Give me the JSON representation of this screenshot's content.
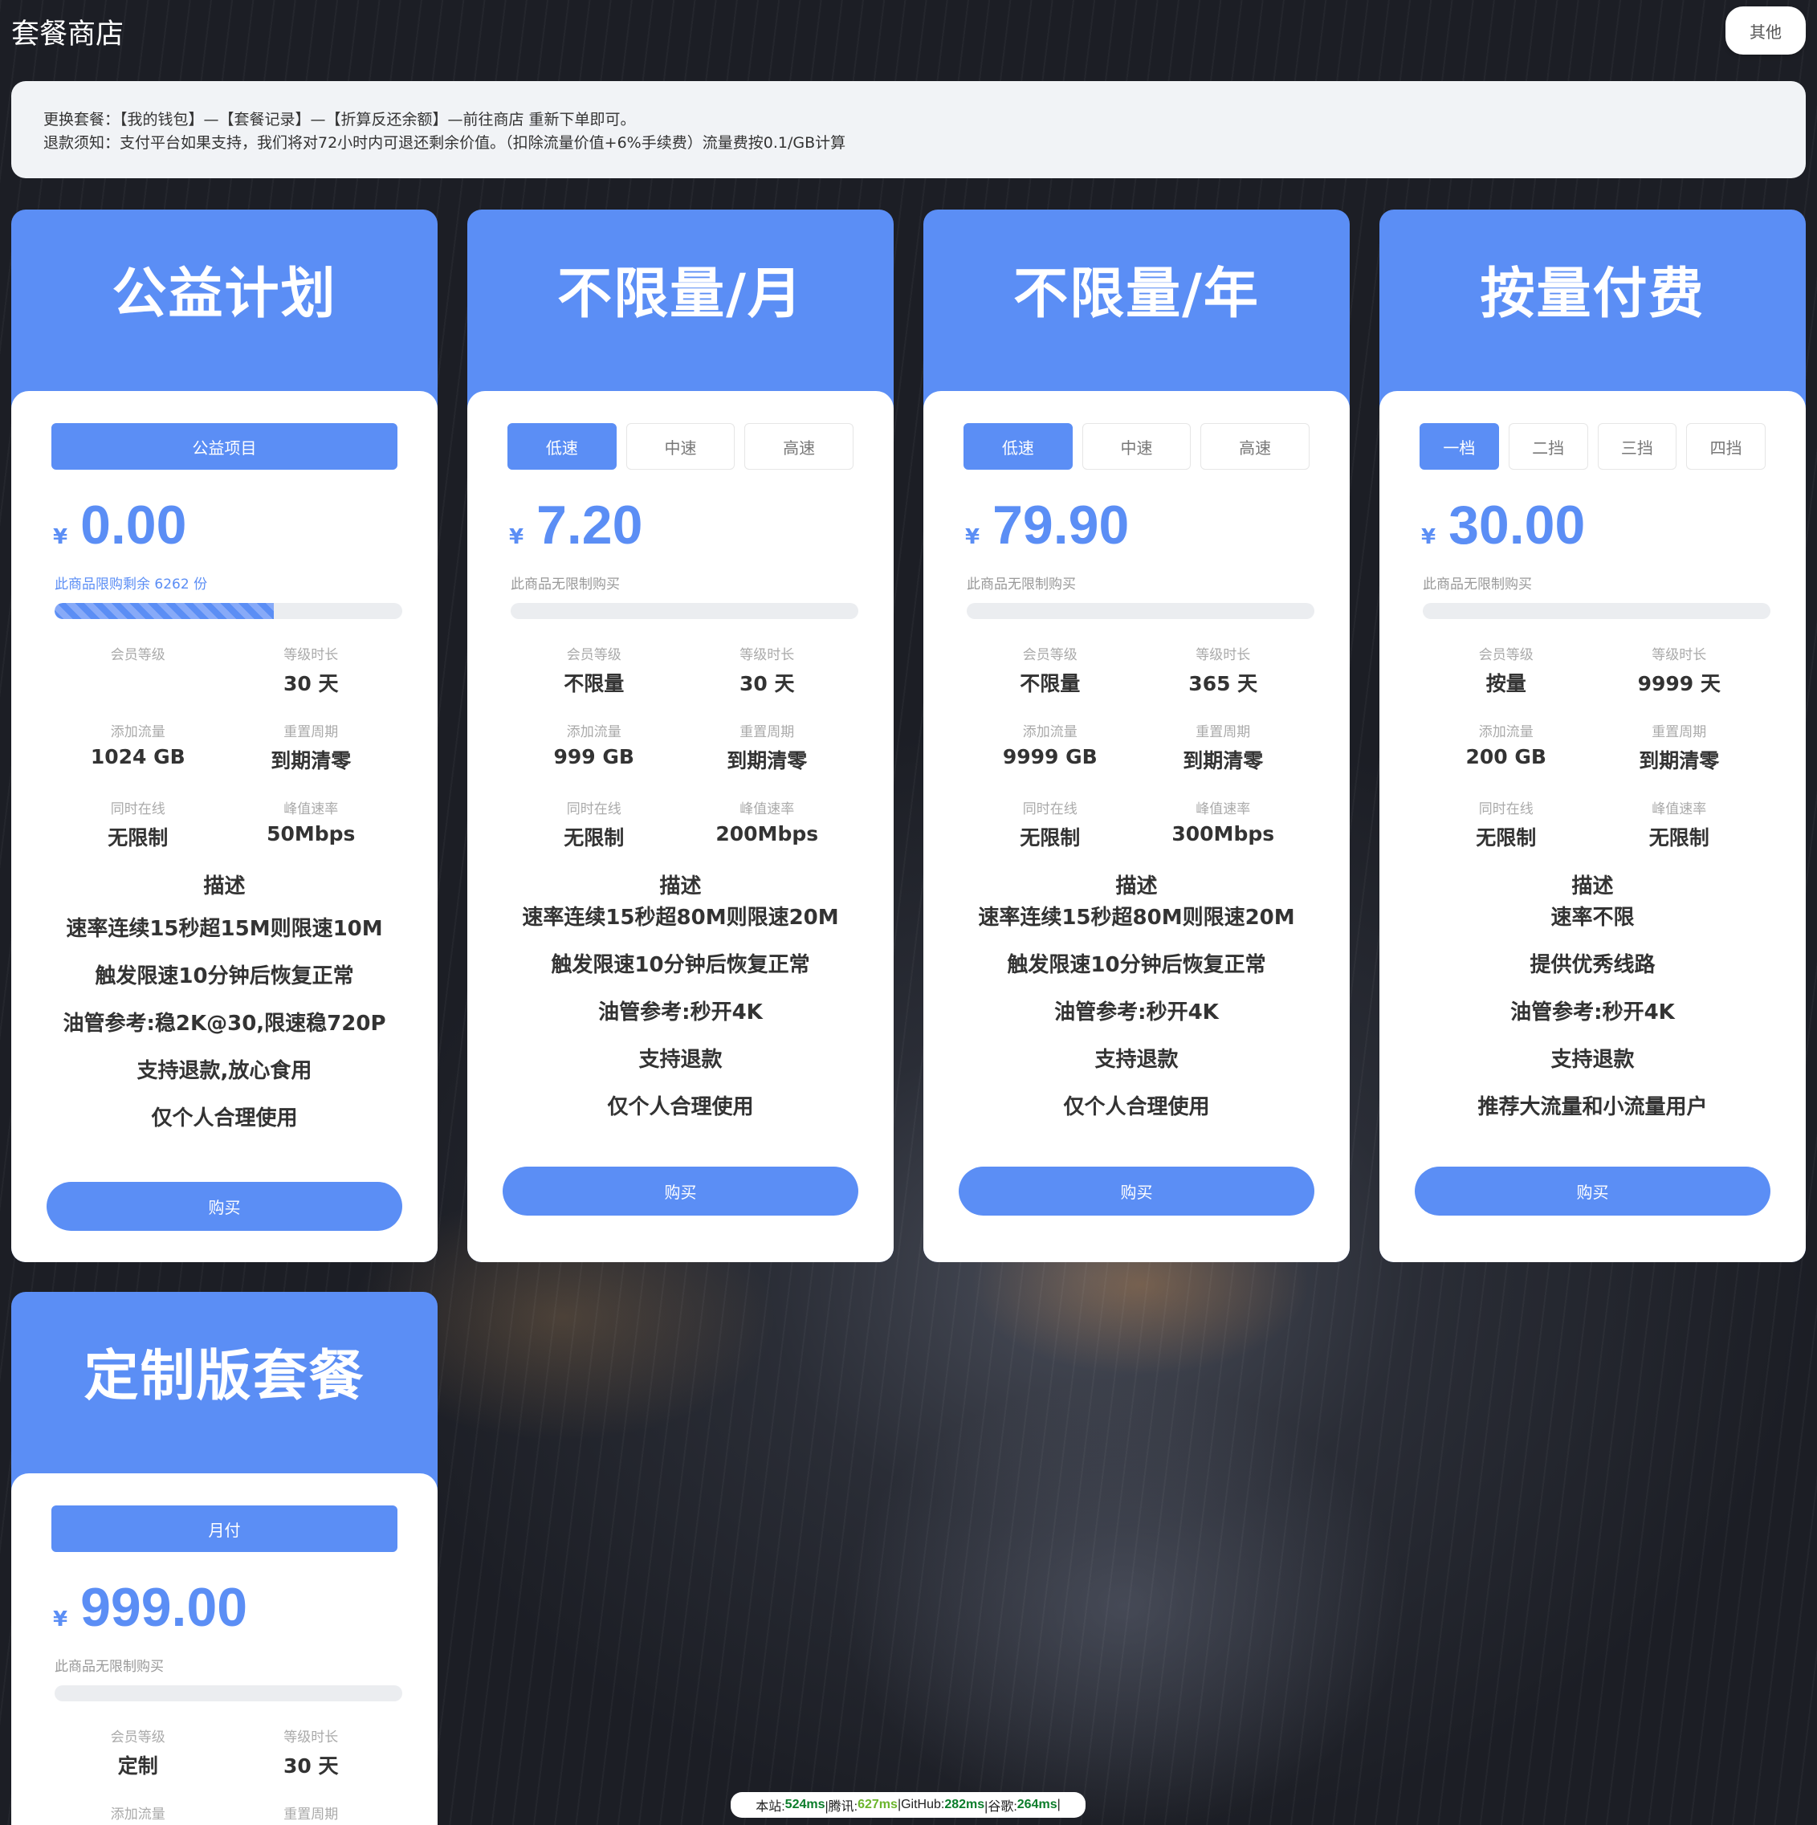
{
  "header": {
    "title": "套餐商店",
    "other_label": "其他"
  },
  "notice": {
    "line1": "更换套餐：【我的钱包】—【套餐记录】—【折算反还余额】—前往商店 重新下单即可。",
    "line2": "退款须知：支付平台如果支持，我们将对72小时内可退还剩余价值。（扣除流量价值+6%手续费）流量费按0.1/GB计算"
  },
  "labels": {
    "level": "会员等级",
    "duration": "等级时长",
    "traffic": "添加流量",
    "reset": "重置周期",
    "online": "同时在线",
    "speed": "峰值速率",
    "desc": "描述",
    "buy": "购买",
    "currency": "¥"
  },
  "cards": [
    {
      "title": "公益计划",
      "tabs": [
        "公益项目"
      ],
      "price": "0.00",
      "limit": "此商品限购剩余 6262 份",
      "stock_fraction": 0.63,
      "level": "",
      "duration": "30 天",
      "traffic": "1024 GB",
      "reset": "到期清零",
      "online": "无限制",
      "speed": "50Mbps",
      "desc": [
        "速率连续15秒超15M则限速10M",
        "触发限速10分钟后恢复正常",
        "油管参考:稳2K@30,限速稳720P",
        "支持退款,放心食用",
        "仅个人合理使用"
      ]
    },
    {
      "title": "不限量/月",
      "tabs": [
        "低速",
        "中速",
        "高速"
      ],
      "price": "7.20",
      "limit": "此商品无限制购买",
      "level": "不限量",
      "duration": "30 天",
      "traffic": "999 GB",
      "reset": "到期清零",
      "online": "无限制",
      "speed": "200Mbps",
      "desc": [
        "速率连续15秒超80M则限速20M",
        "触发限速10分钟后恢复正常",
        "油管参考:秒开4K",
        "支持退款",
        "仅个人合理使用"
      ]
    },
    {
      "title": "不限量/年",
      "tabs": [
        "低速",
        "中速",
        "高速"
      ],
      "price": "79.90",
      "limit": "此商品无限制购买",
      "level": "不限量",
      "duration": "365 天",
      "traffic": "9999 GB",
      "reset": "到期清零",
      "online": "无限制",
      "speed": "300Mbps",
      "desc": [
        "速率连续15秒超80M则限速20M",
        "触发限速10分钟后恢复正常",
        "油管参考:秒开4K",
        "支持退款",
        "仅个人合理使用"
      ]
    },
    {
      "title": "按量付费",
      "tabs": [
        "一档",
        "二挡",
        "三挡",
        "四挡"
      ],
      "price": "30.00",
      "limit": "此商品无限制购买",
      "level": "按量",
      "duration": "9999 天",
      "traffic": "200 GB",
      "reset": "到期清零",
      "online": "无限制",
      "speed": "无限制",
      "desc": [
        "速率不限",
        "提供优秀线路",
        "油管参考:秒开4K",
        "支持退款",
        "推荐大流量和小流量用户"
      ]
    },
    {
      "title": "定制版套餐",
      "tabs": [
        "月付"
      ],
      "price": "999.00",
      "limit": "此商品无限制购买",
      "level": "定制",
      "duration": "30 天",
      "traffic": "",
      "reset": ""
    }
  ],
  "latency": {
    "site_label": "本站:",
    "site_ms": "524ms",
    "tencent_label": "|腾讯:",
    "tencent_ms": "627ms",
    "github_label": "|GitHub:",
    "github_ms": "282ms",
    "google_label": "|谷歌:",
    "google_ms": "264ms",
    "tail": "|"
  },
  "colors": {
    "accent": "#5b8ef5",
    "panel": "#ffffff",
    "notice_bg": "#f1f3f6"
  }
}
